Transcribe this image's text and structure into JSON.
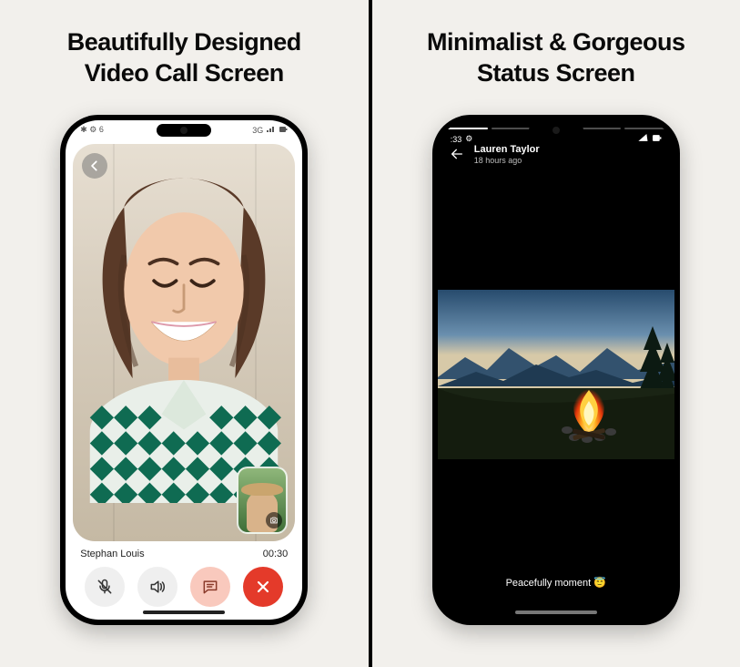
{
  "panels": {
    "left": {
      "headline_l1": "Beautifully Designed",
      "headline_l2": "Video Call Screen"
    },
    "right": {
      "headline_l1": "Minimalist & Gorgeous",
      "headline_l2": "Status Screen"
    }
  },
  "videocall": {
    "statusbar": {
      "left": "✱ ⚙ 6",
      "right_net": "3G",
      "signal_icon": "📶",
      "battery_icon": "▮"
    },
    "caller_name": "Stephan Louis",
    "duration": "00:30",
    "controls": {
      "mute_icon": "mic-off-icon",
      "speaker_icon": "speaker-icon",
      "chat_icon": "chat-icon",
      "end_icon": "close-icon"
    },
    "pip": {
      "camera_switch_icon": "camera-icon"
    },
    "back_icon": "chevron-left-icon"
  },
  "status": {
    "statusbar": {
      "time": ":33",
      "gear": "⚙",
      "signal_icon": "📶",
      "battery_icon": "▮"
    },
    "segments_total": 5,
    "segments_active": 1,
    "author": "Lauren Taylor",
    "posted": "18 hours ago",
    "caption": "Peacefully moment 😇",
    "back_icon": "arrow-left-icon"
  },
  "colors": {
    "end_call": "#e43a2a",
    "chat_btn": "#f9c9bd"
  }
}
